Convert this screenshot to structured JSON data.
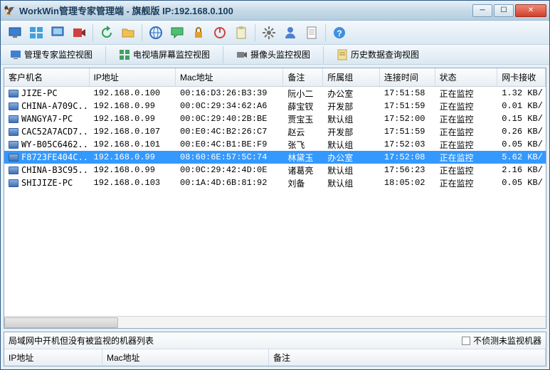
{
  "window": {
    "title": "WorkWin管理专家管理端 - 旗舰版 IP:192.168.0.100"
  },
  "tabs": {
    "t1": "管理专家监控视图",
    "t2": "电视墙屏幕监控视图",
    "t3": "摄像头监控视图",
    "t4": "历史数据查询视图"
  },
  "columns": {
    "c0": "客户机名",
    "c1": "IP地址",
    "c2": "Mac地址",
    "c3": "备注",
    "c4": "所属组",
    "c5": "连接时间",
    "c6": "状态",
    "c7": "网卡接收"
  },
  "status_online": "正在监控",
  "rows": [
    {
      "name": "JIZE-PC",
      "ip": "192.168.0.100",
      "mac": "00:16:D3:26:B3:39",
      "remark": "阮小二",
      "group": "办公室",
      "time": "17:51:58",
      "rx": "1.32 KB/"
    },
    {
      "name": "CHINA-A709C...",
      "ip": "192.168.0.99",
      "mac": "00:0C:29:34:62:A6",
      "remark": "薛宝钗",
      "group": "开发部",
      "time": "17:51:59",
      "rx": "0.01 KB/"
    },
    {
      "name": "WANGYA7-PC",
      "ip": "192.168.0.99",
      "mac": "00:0C:29:40:2B:BE",
      "remark": "贾宝玉",
      "group": "默认组",
      "time": "17:52:00",
      "rx": "0.15 KB/"
    },
    {
      "name": "CAC52A7ACD7...",
      "ip": "192.168.0.107",
      "mac": "00:E0:4C:B2:26:C7",
      "remark": "赵云",
      "group": "开发部",
      "time": "17:51:59",
      "rx": "0.26 KB/"
    },
    {
      "name": "WY-B05C6462...",
      "ip": "192.168.0.101",
      "mac": "00:E0:4C:B1:BE:F9",
      "remark": "张飞",
      "group": "默认组",
      "time": "17:52:03",
      "rx": "0.05 KB/"
    },
    {
      "name": "F8723FE404C...",
      "ip": "192.168.0.99",
      "mac": "08:60:6E:57:5C:74",
      "remark": "林黛玉",
      "group": "办公室",
      "time": "17:52:08",
      "rx": "5.62 KB/",
      "sel": true
    },
    {
      "name": "CHINA-B3C95...",
      "ip": "192.168.0.99",
      "mac": "00:0C:29:42:4D:0E",
      "remark": "诸葛亮",
      "group": "默认组",
      "time": "17:56:23",
      "rx": "2.16 KB/"
    },
    {
      "name": "SHIJIZE-PC",
      "ip": "192.168.0.103",
      "mac": "00:1A:4D:6B:81:92",
      "remark": "刘备",
      "group": "默认组",
      "time": "18:05:02",
      "rx": "0.05 KB/"
    }
  ],
  "bottom": {
    "label": "局域网中开机但没有被监视的机器列表",
    "checkbox": "不侦测未监视机器",
    "c0": "IP地址",
    "c1": "Mac地址",
    "c2": "备注"
  },
  "icons": {
    "app": "🦅"
  }
}
